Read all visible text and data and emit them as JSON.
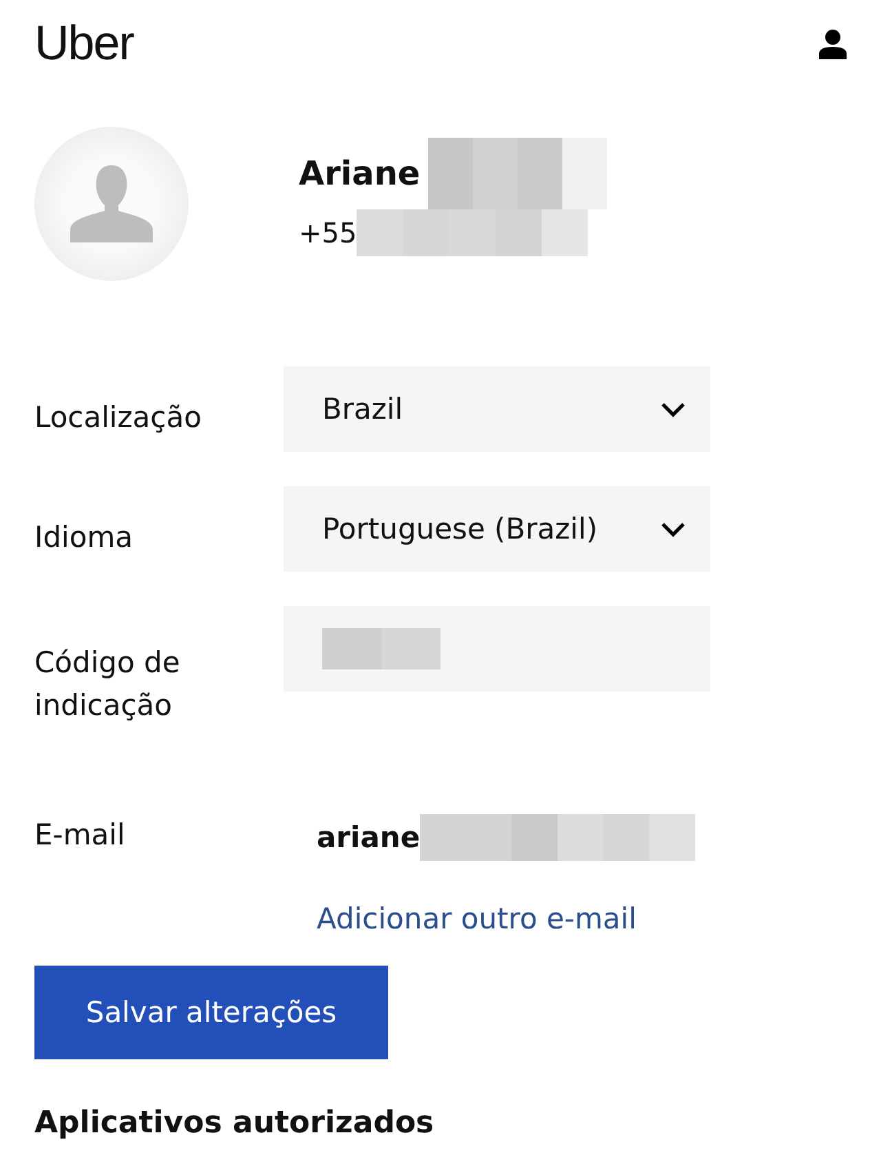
{
  "header": {
    "logo": "Uber"
  },
  "profile": {
    "name": "Ariane",
    "phone": "+55"
  },
  "fields": [
    {
      "kind": "select",
      "label": "Localização",
      "value": "Brazil"
    },
    {
      "kind": "select",
      "label": "Idioma",
      "value": "Portuguese (Brazil)"
    },
    {
      "kind": "input",
      "label": "Código de indicação"
    },
    {
      "kind": "email",
      "label": "E-mail",
      "value": "ariane",
      "link": "Adicionar outro e-mail"
    }
  ],
  "save_button": "Salvar alterações",
  "section_title": "Aplicativos autorizados"
}
